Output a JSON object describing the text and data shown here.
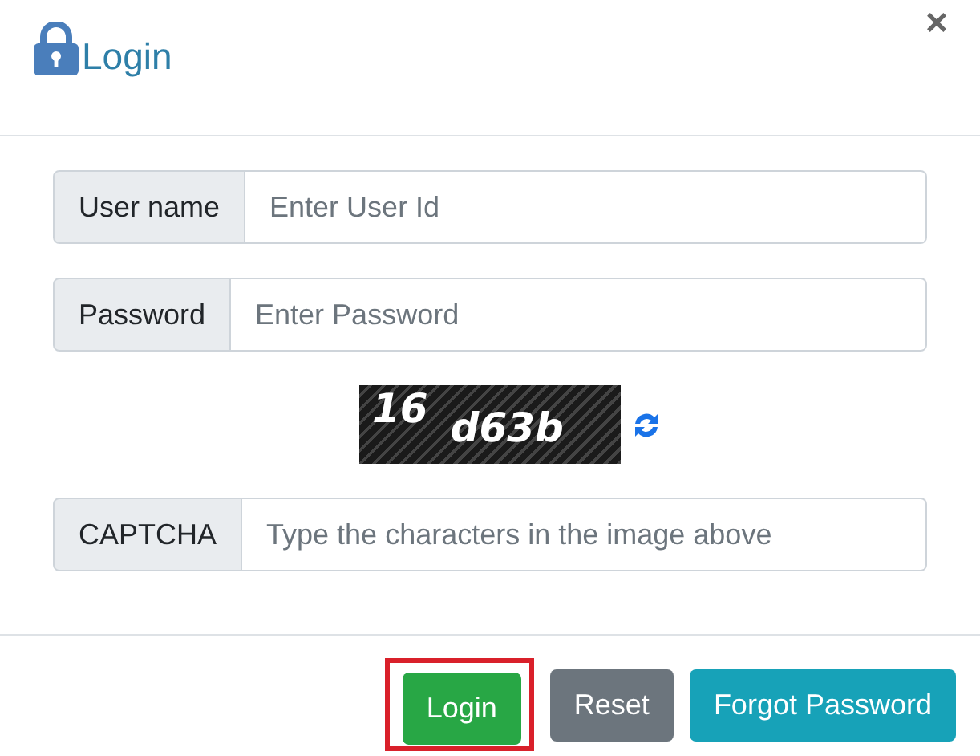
{
  "dialog": {
    "title": "Login",
    "close": "×"
  },
  "fields": [
    {
      "kind": "text",
      "label": "User name",
      "placeholder": "Enter User Id"
    },
    {
      "kind": "password",
      "label": "Password",
      "placeholder": "Enter Password"
    },
    {
      "kind": "captcha-image",
      "texts": [
        "16",
        "d63b"
      ]
    },
    {
      "kind": "text",
      "label": "CAPTCHA",
      "placeholder": "Type the characters in the image above"
    }
  ],
  "buttons": [
    {
      "label": "Login",
      "kind": "success",
      "highlighted": true
    },
    {
      "label": "Reset",
      "kind": "secondary",
      "highlighted": false
    },
    {
      "label": "Forgot Password",
      "kind": "info",
      "highlighted": false
    }
  ]
}
